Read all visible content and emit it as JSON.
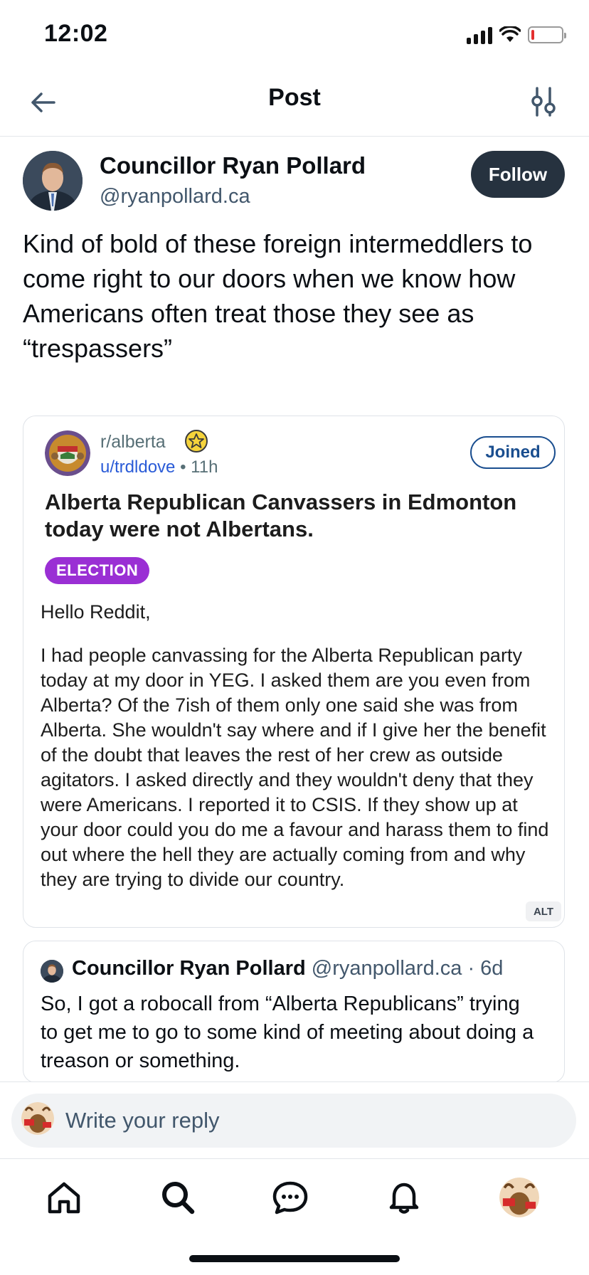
{
  "status_bar": {
    "time": "12:02",
    "icons": [
      "cellular-signal-icon",
      "wifi-icon",
      "battery-low-icon"
    ],
    "battery_color": "#e3302f"
  },
  "header": {
    "title": "Post",
    "back_icon": "arrow-left-icon",
    "filter_icon": "sliders-icon"
  },
  "post": {
    "author_name": "Councillor Ryan Pollard",
    "author_handle": "@ryanpollard.ca",
    "follow_label": "Follow",
    "text": "Kind of bold of these foreign intermeddlers to come right to our doors when we know how Americans often treat those they see as “trespassers”"
  },
  "embed": {
    "subreddit": "r/alberta",
    "user": "u/trdldove",
    "separator": " • ",
    "time": "11h",
    "joined_label": "Joined",
    "title": "Alberta Republican Canvassers in Edmonton today were not Albertans.",
    "flair": "ELECTION",
    "flair_color": "#9a2fd4",
    "greeting": "Hello Reddit,",
    "body": "I had people canvassing for the Alberta Republican party today at my door in YEG. I asked them are you even from Alberta? Of the 7ish of them only one said she was from Alberta. She wouldn't say where and if I give her the benefit of the doubt that leaves the rest of her crew as outside agitators. I asked directly and they wouldn't deny that they were Americans. I reported it to CSIS. If they show up at your door could you do me a favour and harass them to find out where the hell they are actually coming from and why they are trying to divide our country.",
    "alt_label": "ALT"
  },
  "quoted_post": {
    "author_name": "Councillor Ryan Pollard",
    "author_handle": "@ryanpollard.ca",
    "separator": " · ",
    "time": "6d",
    "text": "So, I got a robocall from “Alberta Republicans” trying to get me to go to some kind of meeting about doing a treason or something."
  },
  "reply": {
    "placeholder": "Write your reply"
  },
  "bottom_nav": {
    "items": [
      "home-icon",
      "search-icon",
      "chat-icon",
      "bell-icon",
      "profile-avatar"
    ]
  },
  "colors": {
    "follow_bg": "#26323f",
    "handle": "#42576c",
    "reddit_link": "#2a5bd7",
    "joined_border": "#1a4e8f"
  }
}
